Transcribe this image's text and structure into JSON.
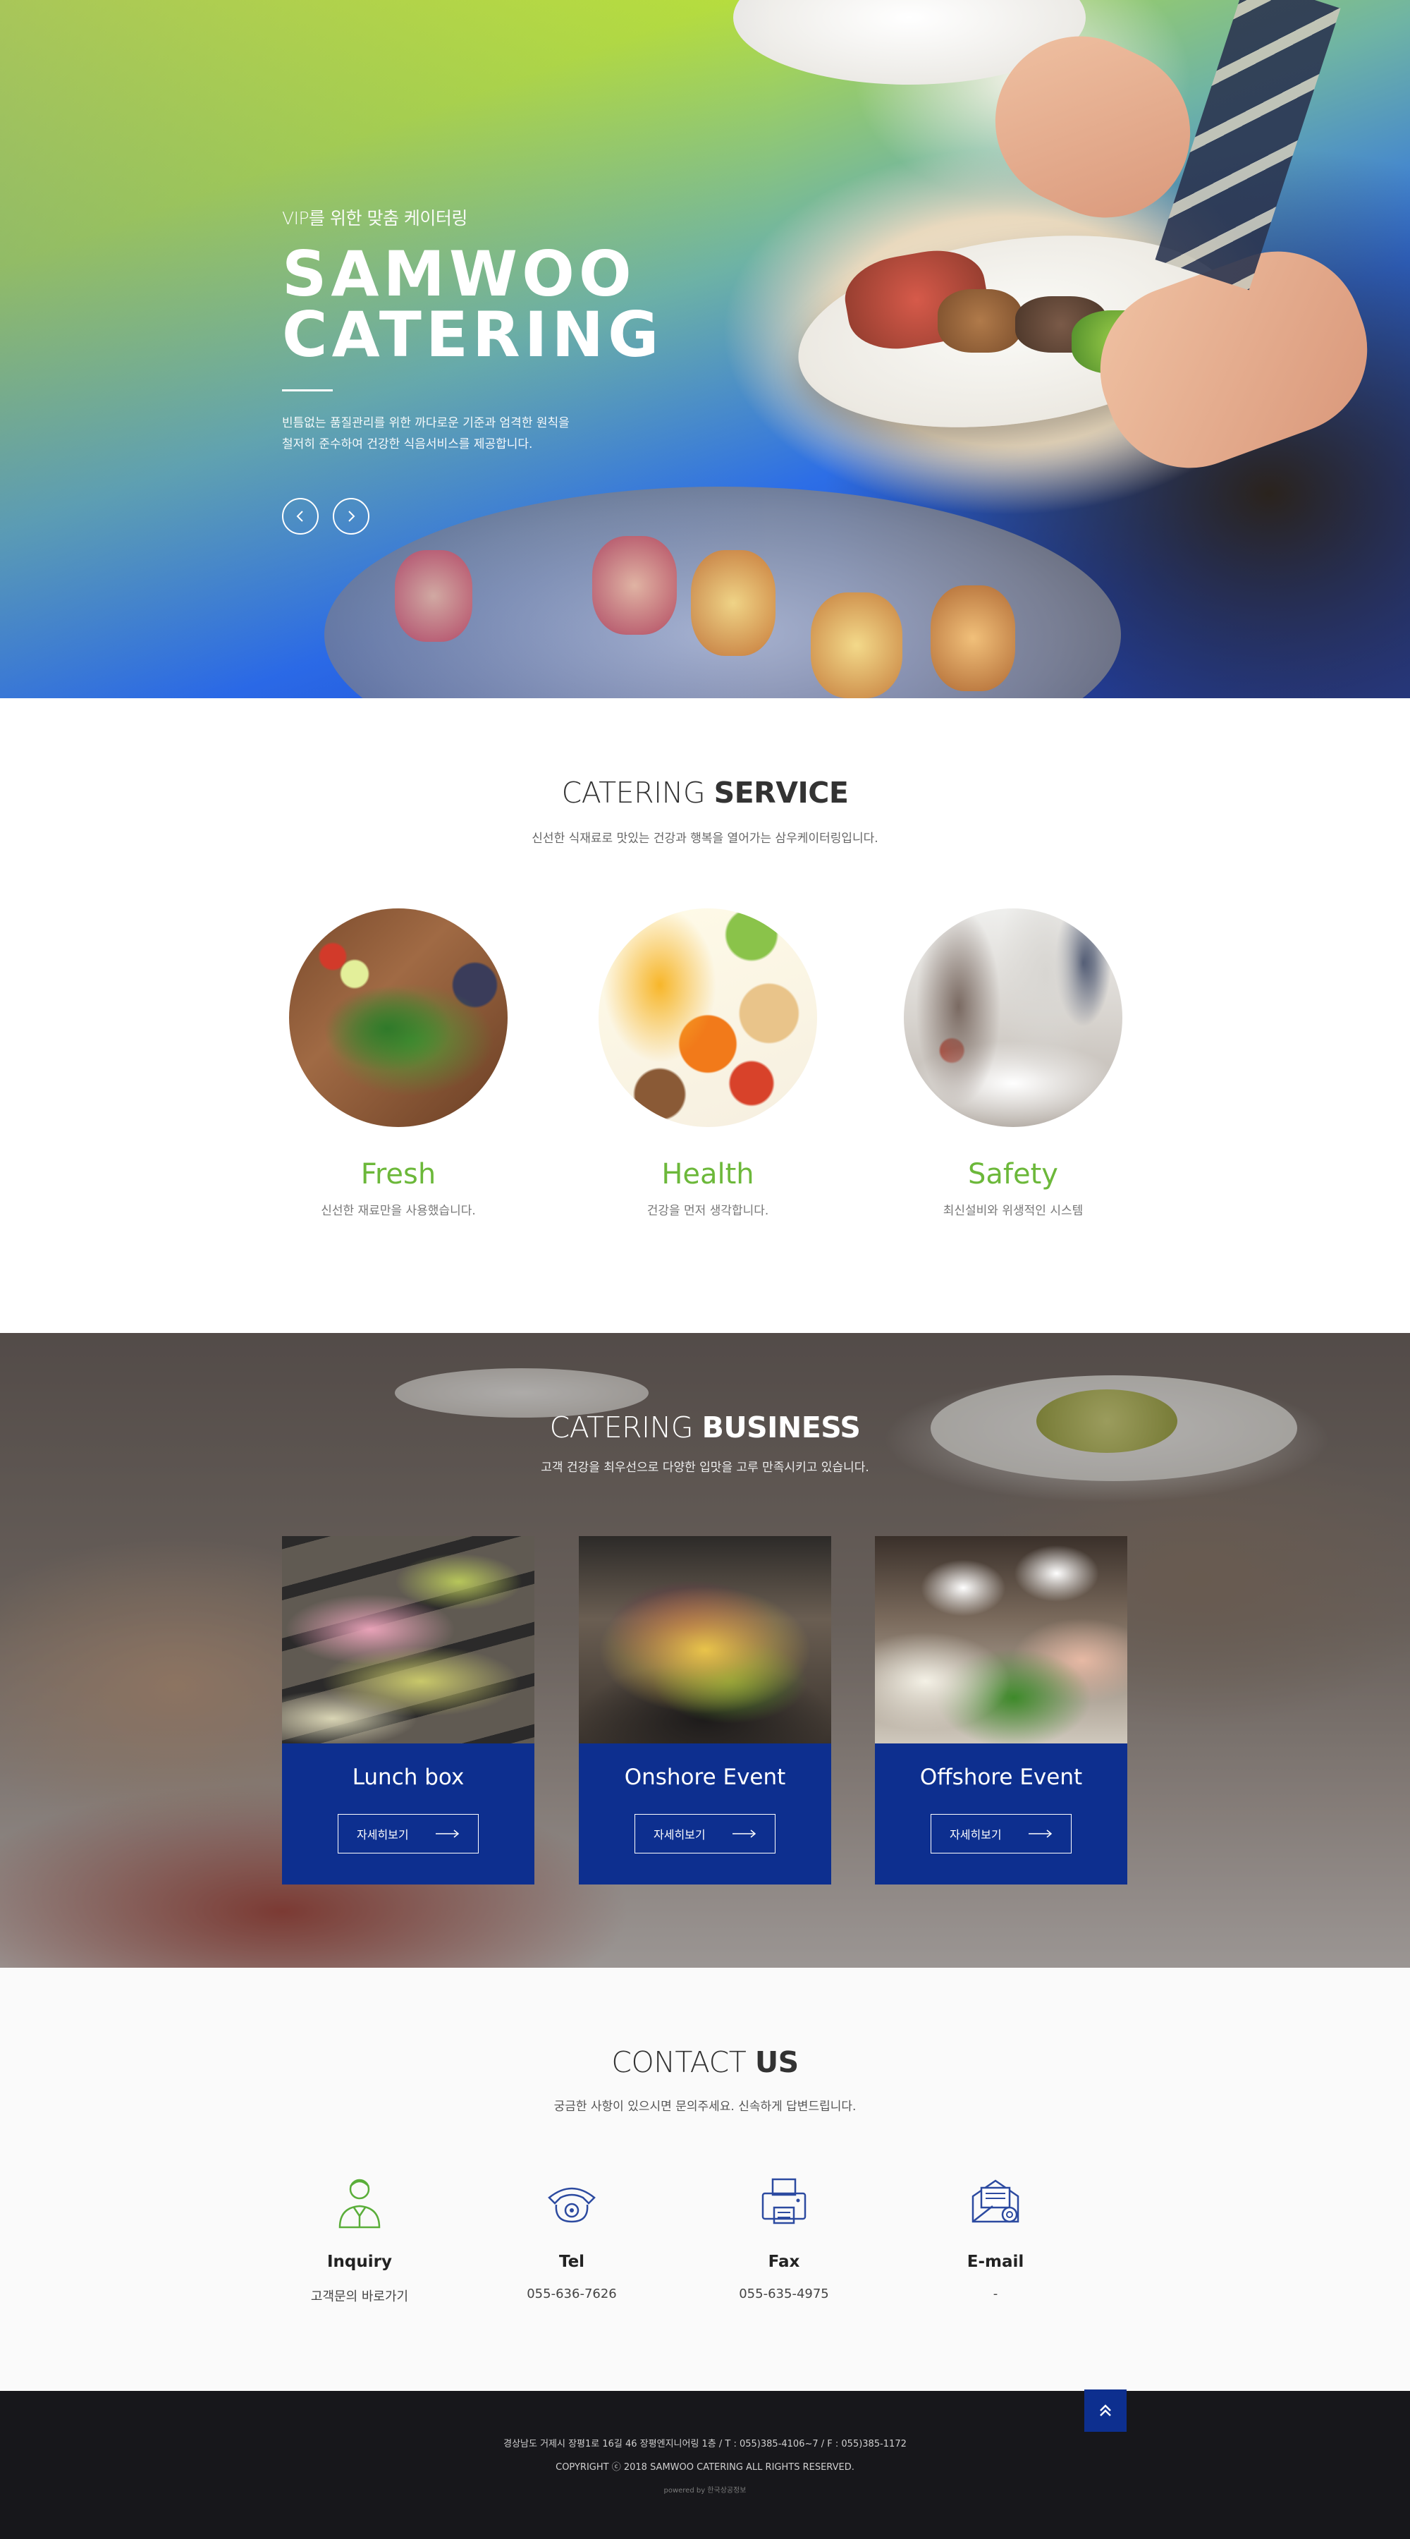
{
  "hero": {
    "subtitle": "VIP를 위한 맞춤 케이터링",
    "title_line1": "SAMWOO",
    "title_line2": "CATERING",
    "desc_line1": "빈틈없는 품질관리를 위한 까다로운 기준과 엄격한 원칙을",
    "desc_line2": "철저히 준수하여 건강한 식음서비스를 제공합니다.",
    "prev_icon": "chevron-left-icon",
    "next_icon": "chevron-right-icon"
  },
  "service": {
    "title_light": "CATERING ",
    "title_bold": "SERVICE",
    "subtitle": "신선한 식재료로 맛있는 건강과 행복을 열어가는 삼우케이터링입니다.",
    "items": [
      {
        "name": "Fresh",
        "desc": "신선한 재료만을 사용했습니다."
      },
      {
        "name": "Health",
        "desc": "건강을 먼저 생각합니다."
      },
      {
        "name": "Safety",
        "desc": "최신설비와 위생적인 시스템"
      }
    ]
  },
  "business": {
    "title_light": "CATERING ",
    "title_bold": "BUSINESS",
    "subtitle": "고객 건강을 최우선으로 다양한 입맛을 고루 만족시키고 있습니다.",
    "cards": [
      {
        "name": "Lunch box",
        "button": "자세히보기"
      },
      {
        "name": "Onshore Event",
        "button": "자세히보기"
      },
      {
        "name": "Offshore Event",
        "button": "자세히보기"
      }
    ]
  },
  "contact": {
    "title_light": "CONTACT ",
    "title_bold": "US",
    "subtitle": "궁금한 사항이 있으시면 문의주세요. 신속하게 답변드립니다.",
    "items": [
      {
        "label": "Inquiry",
        "value": "고객문의 바로가기",
        "icon": "person-icon"
      },
      {
        "label": "Tel",
        "value": "055-636-7626",
        "icon": "telephone-icon"
      },
      {
        "label": "Fax",
        "value": "055-635-4975",
        "icon": "fax-icon"
      },
      {
        "label": "E-mail",
        "value": "-",
        "icon": "email-icon"
      }
    ]
  },
  "footer": {
    "address": "경상남도 거제시 장평1로 16길 46 장평엔지니어링 1층  /  T : 055)385-4106~7  /  F : 055)385-1172",
    "copyright": "COPYRIGHT ⓒ 2018 SAMWOO CATERING ALL RIGHTS RESERVED.",
    "powered": "powered by 한국상공정보"
  }
}
